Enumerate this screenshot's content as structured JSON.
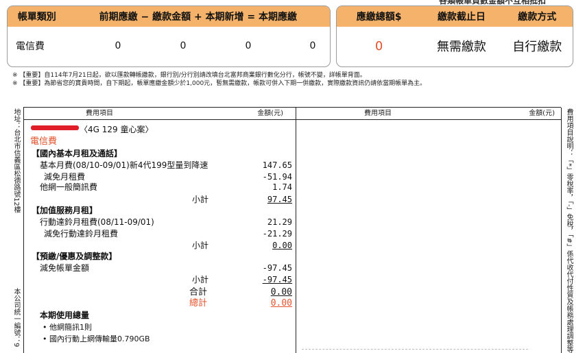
{
  "summary_left": {
    "headers": [
      "帳單類別",
      "前期應繳 − 繳款金額 + 本期新增 = 本期應繳"
    ],
    "row_label": "電信費",
    "values": [
      "0",
      "0",
      "0",
      "0"
    ]
  },
  "summary_right": {
    "top_note": "各類帳單負數金額不互相抵扣",
    "headers": [
      "應繳總額$",
      "繳款截止日",
      "繳款方式"
    ],
    "values": [
      "0",
      "無需繳款",
      "自行繳款"
    ]
  },
  "notes": [
    "※ 【重要】自114年7月21日起，欲以匯款轉帳繳款，銀行別/分行別請改填台北富邦商業銀行數化分行，帳號不變，詳帳單背面。",
    "※ 【重要】為節省您的寶貴時間，自下期起，帳單應繳金額少於1,000元，暫無需繳款，帳款可併入下期一併繳款，實際繳款資訊仍請依當期帳單為主。"
  ],
  "side_left_top": "地址：台北市信義區松德路號12樓",
  "side_left_bottom": "本公司統一編號：9",
  "side_right": "費用項目說明：「*」零稅率，「-」免稅，「#」係代收代付性質及帳務處理調整等。",
  "table_headers": {
    "item": "費用項目",
    "amount": "金額(元)",
    "item2": "費用項目",
    "amount2": "金額(元)"
  },
  "account_suffix": "〈4G 129 童心案〉",
  "section_title": "電信費",
  "groups": {
    "g1_title": "【國內基本月租及通話】",
    "g1_items": [
      {
        "label": "基本月費(08/10-09/01)新4代199型量到降速",
        "amount": "147.65"
      },
      {
        "label": "減免月租費",
        "amount": "-51.94"
      },
      {
        "label": "他網一般簡訊費",
        "amount": "1.74"
      }
    ],
    "g1_subtotal_label": "小計",
    "g1_subtotal": "97.45",
    "g2_title": "【加值服務月租】",
    "g2_items": [
      {
        "label": "行動達鈴月租費(08/11-09/01)",
        "amount": "21.29"
      },
      {
        "label": "減免行動達鈴月租費",
        "amount": "-21.29"
      }
    ],
    "g2_subtotal_label": "小計",
    "g2_subtotal": "0.00",
    "g3_title": "【預繳/優惠及調整款】",
    "g3_items": [
      {
        "label": "減免帳單金額",
        "amount": "-97.45"
      }
    ],
    "g3_subtotal_label": "小計",
    "g3_subtotal": "-97.45",
    "sum_label": "合計",
    "sum": "0.00",
    "total_label": "總計",
    "total": "0.00"
  },
  "usage": {
    "title": "本期使用總量",
    "items": [
      "• 他網簡訊1則",
      "• 國內行動上網傳輸量0.790GB"
    ]
  },
  "colors": {
    "header_bg": "#f4b26a",
    "accent_red": "#e4512b"
  }
}
